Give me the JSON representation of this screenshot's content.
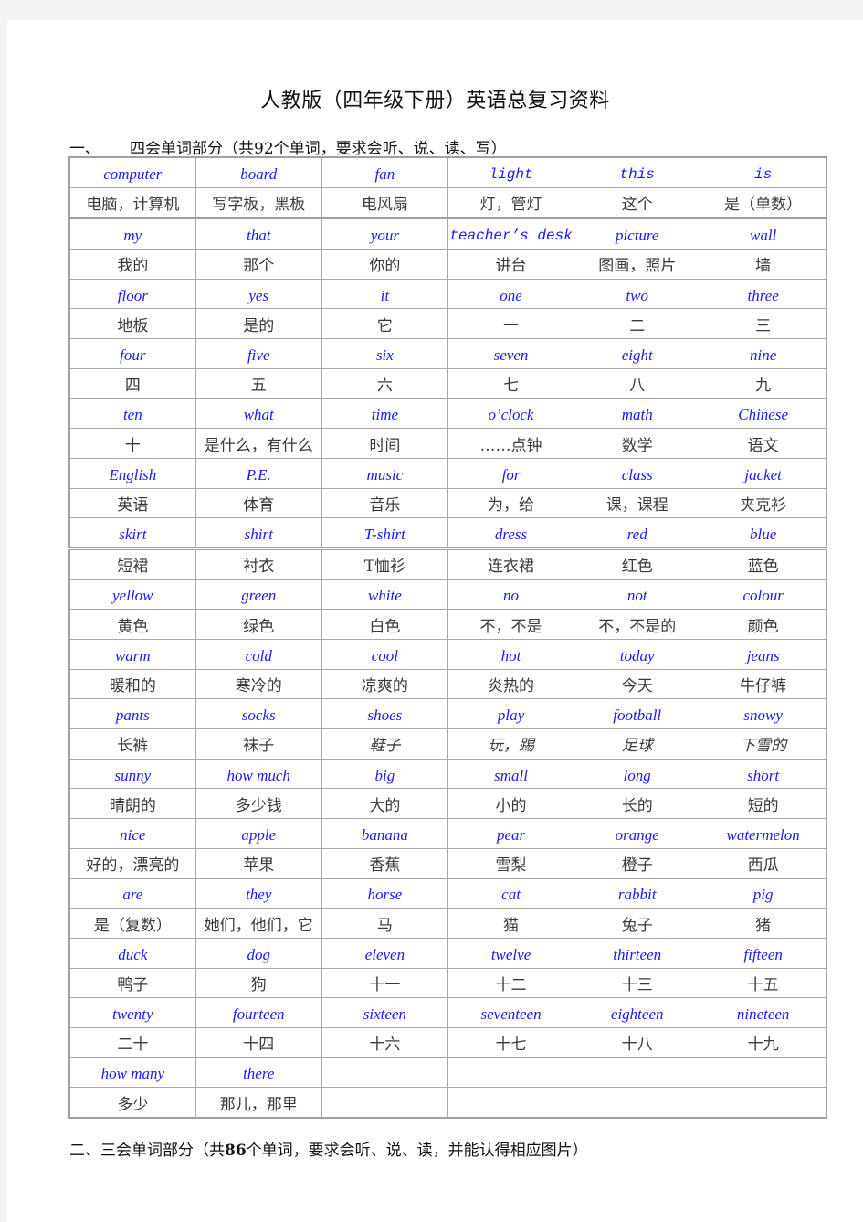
{
  "document": {
    "title": "人教版（四年级下册）英语总复习资料",
    "section1": {
      "number": "一、",
      "heading": "四会单词部分（共92个单词，要求会听、说、读、写）"
    },
    "section2": {
      "prefix": "二、三会单词部分（共",
      "count": "86",
      "suffix": "个单词，要求会听、说、读，并能认得相应图片）"
    },
    "colors": {
      "english_text": "#1a1aff",
      "chinese_text": "#3a3a3a",
      "border": "#a8a8a8"
    }
  },
  "vocab_rows": [
    {
      "en": [
        "computer",
        "board",
        "fan",
        "light",
        "this",
        "is"
      ],
      "zh": [
        "电脑，计算机",
        "写字板，黑板",
        "电风扇",
        "灯，管灯",
        "这个",
        "是（单数）"
      ]
    },
    {
      "en": [
        "my",
        "that",
        "your",
        "teacher’s desk",
        "picture",
        "wall"
      ],
      "zh": [
        "我的",
        "那个",
        "你的",
        "讲台",
        "图画，照片",
        "墙"
      ]
    },
    {
      "en": [
        "floor",
        "yes",
        "it",
        "one",
        "two",
        "three"
      ],
      "zh": [
        "地板",
        "是的",
        "它",
        "一",
        "二",
        "三"
      ]
    },
    {
      "en": [
        "four",
        "five",
        "six",
        "seven",
        "eight",
        "nine"
      ],
      "zh": [
        "四",
        "五",
        "六",
        "七",
        "八",
        "九"
      ]
    },
    {
      "en": [
        "ten",
        "what",
        "time",
        "o’clock",
        "math",
        "Chinese"
      ],
      "zh": [
        "十",
        "是什么，有什么",
        "时间",
        "……点钟",
        "数学",
        "语文"
      ]
    },
    {
      "en": [
        "English",
        "P.E.",
        "music",
        "for",
        "class",
        "jacket"
      ],
      "zh": [
        "英语",
        "体育",
        "音乐",
        "为，给",
        "课，课程",
        "夹克衫"
      ]
    },
    {
      "en": [
        "skirt",
        "shirt",
        "T-shirt",
        "dress",
        "red",
        "blue"
      ],
      "zh": [
        "短裙",
        "衬衣",
        "T恤衫",
        "连衣裙",
        "红色",
        "蓝色"
      ]
    },
    {
      "en": [
        "yellow",
        "green",
        "white",
        "no",
        "not",
        "colour"
      ],
      "zh": [
        "黄色",
        "绿色",
        "白色",
        "不，不是",
        "不，不是的",
        "颜色"
      ]
    },
    {
      "en": [
        "warm",
        "cold",
        "cool",
        "hot",
        "today",
        "jeans"
      ],
      "zh": [
        "暖和的",
        "寒冷的",
        "凉爽的",
        "炎热的",
        "今天",
        "牛仔裤"
      ]
    },
    {
      "en": [
        "pants",
        "socks",
        "shoes",
        "play",
        "football",
        "snowy"
      ],
      "zh": [
        "长裤",
        "袜子",
        "鞋子",
        "玩，踢",
        "足球",
        "下雪的"
      ]
    },
    {
      "en": [
        "sunny",
        "how much",
        "big",
        "small",
        "long",
        "short"
      ],
      "zh": [
        "晴朗的",
        "多少钱",
        "大的",
        "小的",
        "长的",
        "短的"
      ]
    },
    {
      "en": [
        "nice",
        "apple",
        "banana",
        "pear",
        "orange",
        "watermelon"
      ],
      "zh": [
        "好的，漂亮的",
        "苹果",
        "香蕉",
        "雪梨",
        "橙子",
        "西瓜"
      ]
    },
    {
      "en": [
        "are",
        "they",
        "horse",
        "cat",
        "rabbit",
        "pig"
      ],
      "zh": [
        "是（复数）",
        "她们，他们，它",
        "马",
        "猫",
        "兔子",
        "猪"
      ]
    },
    {
      "en": [
        "duck",
        "dog",
        "eleven",
        "twelve",
        "thirteen",
        "fifteen"
      ],
      "zh": [
        "鸭子",
        "狗",
        "十一",
        "十二",
        "十三",
        "十五"
      ]
    },
    {
      "en": [
        "twenty",
        "fourteen",
        "sixteen",
        "seventeen",
        "eighteen",
        "nineteen"
      ],
      "zh": [
        "二十",
        "十四",
        "十六",
        "十七",
        "十八",
        "十九"
      ]
    },
    {
      "en": [
        "how many",
        "there",
        "",
        "",
        "",
        ""
      ],
      "zh": [
        "多少",
        "那儿，那里",
        "",
        "",
        "",
        ""
      ]
    }
  ]
}
